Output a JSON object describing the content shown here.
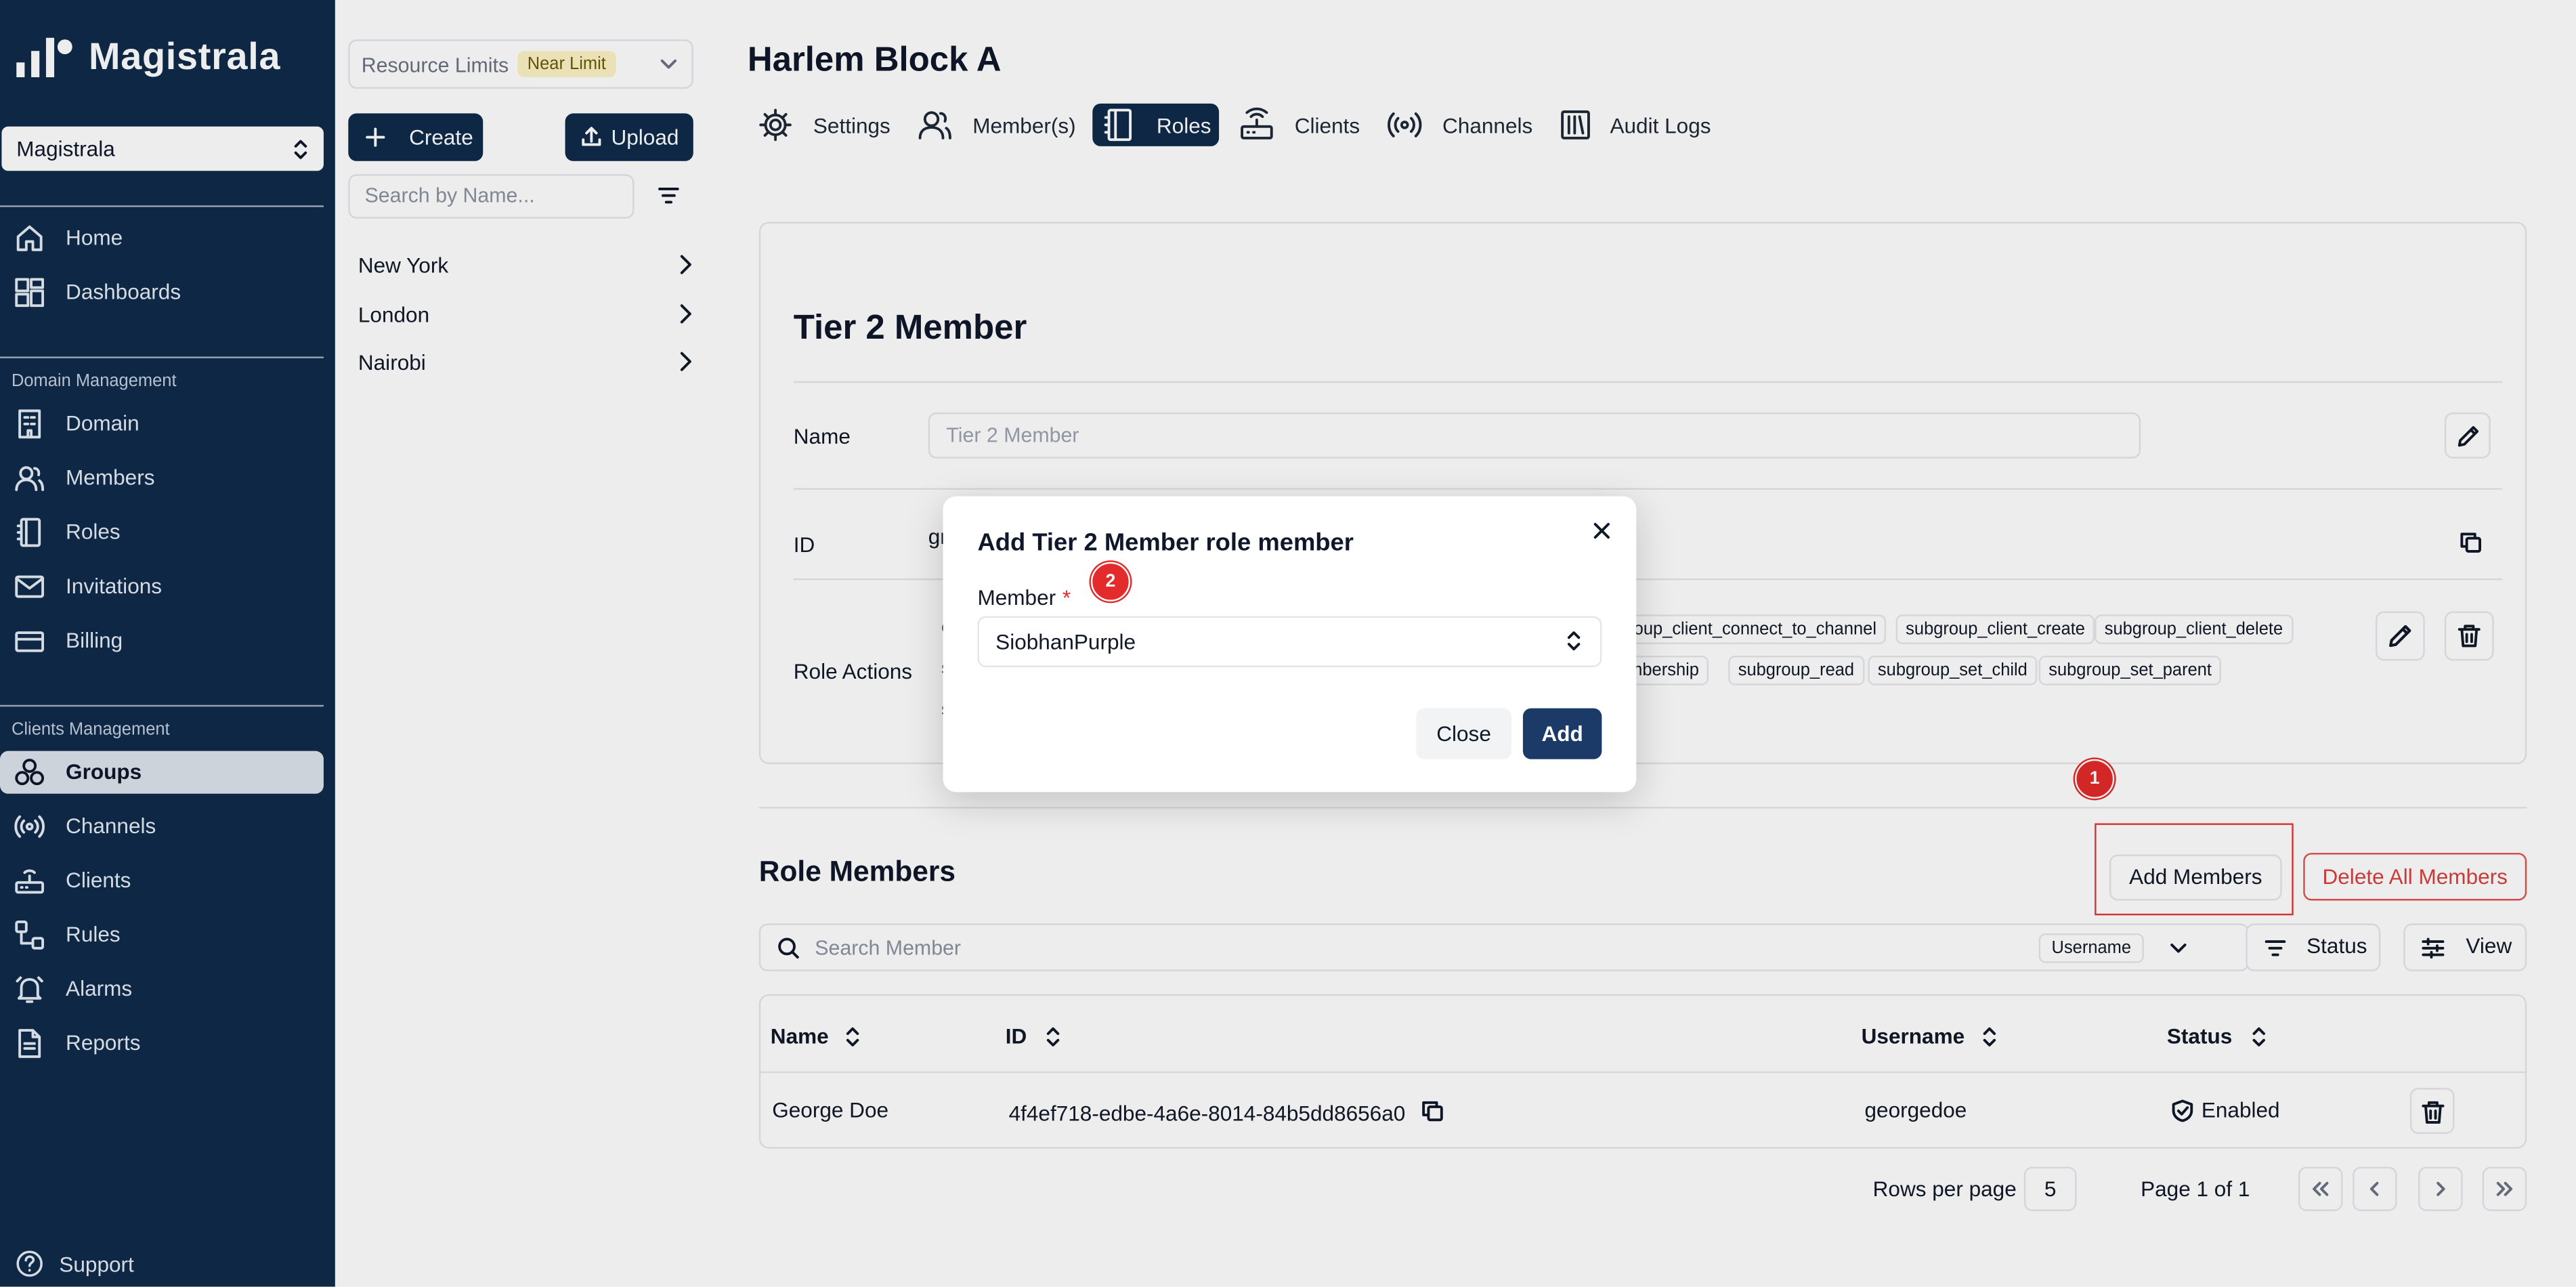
{
  "sidebar": {
    "brand": "Magistrala",
    "domain_select": "Magistrala",
    "items_top": [
      {
        "label": "Home",
        "icon": "home-icon"
      },
      {
        "label": "Dashboards",
        "icon": "dashboard-icon"
      }
    ],
    "section_domain": "Domain Management",
    "items_domain": [
      {
        "label": "Domain",
        "icon": "building-icon"
      },
      {
        "label": "Members",
        "icon": "users-icon"
      },
      {
        "label": "Roles",
        "icon": "book-icon"
      },
      {
        "label": "Invitations",
        "icon": "mail-icon"
      },
      {
        "label": "Billing",
        "icon": "card-icon"
      }
    ],
    "section_clients": "Clients Management",
    "items_clients": [
      {
        "label": "Groups",
        "icon": "groups-icon",
        "active": true
      },
      {
        "label": "Channels",
        "icon": "broadcast-icon"
      },
      {
        "label": "Clients",
        "icon": "router-icon"
      },
      {
        "label": "Rules",
        "icon": "workflow-icon"
      },
      {
        "label": "Alarms",
        "icon": "bell-icon"
      },
      {
        "label": "Reports",
        "icon": "file-icon"
      }
    ],
    "support": "Support"
  },
  "groups_panel": {
    "resource_limits": "Resource Limits",
    "limit_badge": "Near Limit",
    "create": "Create",
    "upload": "Upload",
    "search_placeholder": "Search by Name...",
    "groups": [
      "New York",
      "London",
      "Nairobi"
    ]
  },
  "main": {
    "title": "Harlem Block A",
    "tabs": [
      {
        "label": "Settings",
        "icon": "gear-icon"
      },
      {
        "label": "Member(s)",
        "icon": "users-icon"
      },
      {
        "label": "Roles",
        "icon": "book-icon",
        "active": true
      },
      {
        "label": "Clients",
        "icon": "router-icon"
      },
      {
        "label": "Channels",
        "icon": "broadcast-icon"
      },
      {
        "label": "Audit Logs",
        "icon": "logs-icon"
      }
    ]
  },
  "role": {
    "title": "Tier 2 Member",
    "name_label": "Name",
    "name_value": "Tier 2 Member",
    "id_label": "ID",
    "id_partial": "gr",
    "actions_label": "Role Actions",
    "chips_row1": [
      "roup_client_connect_to_channel",
      "subgroup_client_create",
      "subgroup_client_delete"
    ],
    "chips_row2": [
      "mbership",
      "subgroup_read",
      "subgroup_set_child",
      "subgroup_set_parent"
    ]
  },
  "members": {
    "title": "Role Members",
    "add_button": "Add Members",
    "delete_all_button": "Delete All Members",
    "search_placeholder": "Search Member",
    "search_field": "Username",
    "status_filter": "Status",
    "view_button": "View",
    "columns": [
      "Name",
      "ID",
      "Username",
      "Status"
    ],
    "rows": [
      {
        "name": "George Doe",
        "id": "4f4ef718-edbe-4a6e-8014-84b5dd8656a0",
        "username": "georgedoe",
        "status": "Enabled"
      }
    ],
    "rows_per_page_label": "Rows per page",
    "rows_per_page": "5",
    "page_info": "Page 1 of 1"
  },
  "annotations": {
    "step1": "1",
    "step2": "2"
  },
  "modal": {
    "title": "Add Tier 2 Member role member",
    "member_label": "Member",
    "required_mark": "*",
    "member_value": "SiobhanPurple",
    "close": "Close",
    "add": "Add"
  },
  "colors": {
    "sidebar_bg": "#0f2a4a",
    "primary": "#1b3a68",
    "danger": "#d9403e",
    "annotation_red": "#e32b2b",
    "badge_bg": "#fdf3c4"
  }
}
